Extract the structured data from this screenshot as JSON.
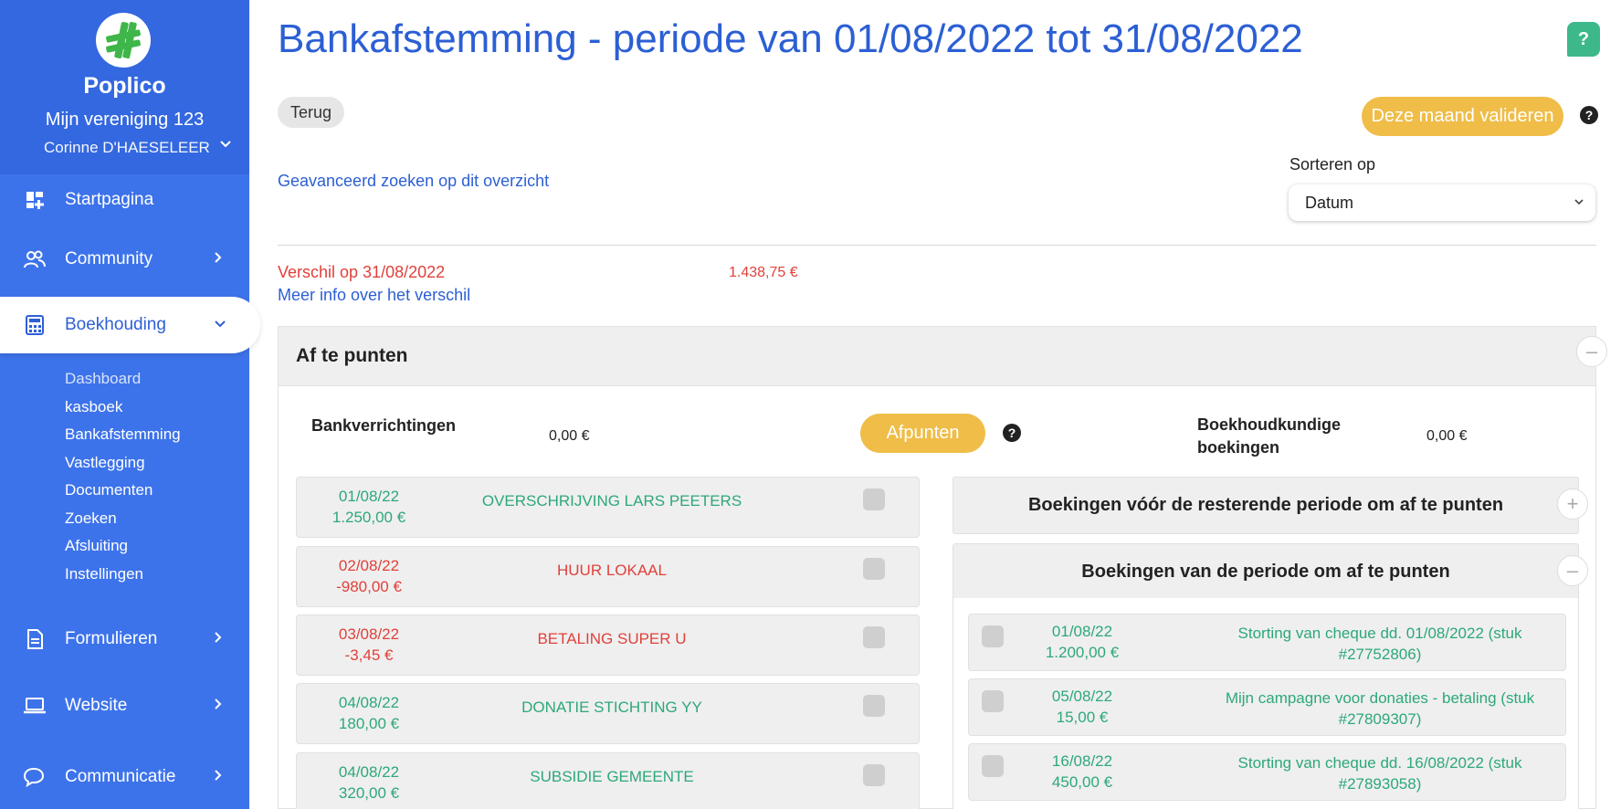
{
  "sidebar": {
    "brand": "Poplico",
    "organization": "Mijn vereniging 123",
    "user": "Corinne D'HAESELEER",
    "nav": {
      "startpagina": "Startpagina",
      "community": "Community",
      "boekhouding": "Boekhouding",
      "formulieren": "Formulieren",
      "website": "Website",
      "communicatie": "Communicatie"
    },
    "subnav": [
      "Dashboard",
      "kasboek",
      "Bankafstemming",
      "Vastlegging",
      "Documenten",
      "Zoeken",
      "Afsluiting",
      "Instellingen"
    ]
  },
  "header": {
    "title": "Bankafstemming - periode van 01/08/2022 tot 31/08/2022",
    "help": "?"
  },
  "toolbar": {
    "back_label": "Terug",
    "validate_label": "Deze maand valideren",
    "help": "?",
    "advanced_search": "Geavanceerd zoeken op dit overzicht",
    "sort_label": "Sorteren op",
    "sort_value": "Datum"
  },
  "difference": {
    "label": "Verschil op 31/08/2022",
    "amount": "1.438,75 €",
    "more_info": "Meer info over het verschil"
  },
  "panel": {
    "title": "Af te punten",
    "collapse": "–",
    "bank_label": "Bankverrichtingen",
    "bank_total": "0,00 €",
    "afpunten_label": "Afpunten",
    "help": "?",
    "book_label": "Boekhoudkundige boekingen",
    "book_total": "0,00 €"
  },
  "bank_transactions": [
    {
      "date": "01/08/22",
      "amount": "1.250,00 €",
      "description": "OVERSCHRIJVING LARS PEETERS",
      "color": "#2da87a"
    },
    {
      "date": "02/08/22",
      "amount": "-980,00 €",
      "description": "HUUR LOKAAL",
      "color": "#e0413b"
    },
    {
      "date": "03/08/22",
      "amount": "-3,45 €",
      "description": "BETALING SUPER U",
      "color": "#e0413b"
    },
    {
      "date": "04/08/22",
      "amount": "180,00 €",
      "description": "DONATIE STICHTING YY",
      "color": "#2da87a"
    },
    {
      "date": "04/08/22",
      "amount": "320,00 €",
      "description": "SUBSIDIE GEMEENTE",
      "color": "#2da87a"
    }
  ],
  "bookings_before": {
    "title": "Boekingen vóór de resterende periode om af te punten",
    "toggle": "+"
  },
  "bookings_period": {
    "title": "Boekingen van de periode om af te punten",
    "toggle": "–",
    "items": [
      {
        "date": "01/08/22",
        "amount": "1.200,00 €",
        "description": "Storting van cheque dd. 01/08/2022 (stuk #27752806)"
      },
      {
        "date": "05/08/22",
        "amount": "15,00 €",
        "description": "Mijn campagne voor donaties  - betaling (stuk #27809307)"
      },
      {
        "date": "16/08/22",
        "amount": "450,00 €",
        "description": "Storting van cheque dd. 16/08/2022 (stuk #27893058)"
      }
    ]
  },
  "colors": {
    "sidebar": "#3d73ea",
    "accent_blue": "#2c5fd4",
    "accent_yellow": "#efbd48",
    "positive": "#2da87a",
    "negative": "#e0413b"
  },
  "icons": {
    "startpagina": "dashboard-icon",
    "community": "users-icon",
    "boekhouding": "calculator-icon",
    "formulieren": "document-icon",
    "website": "laptop-icon",
    "communicatie": "chat-icon"
  }
}
